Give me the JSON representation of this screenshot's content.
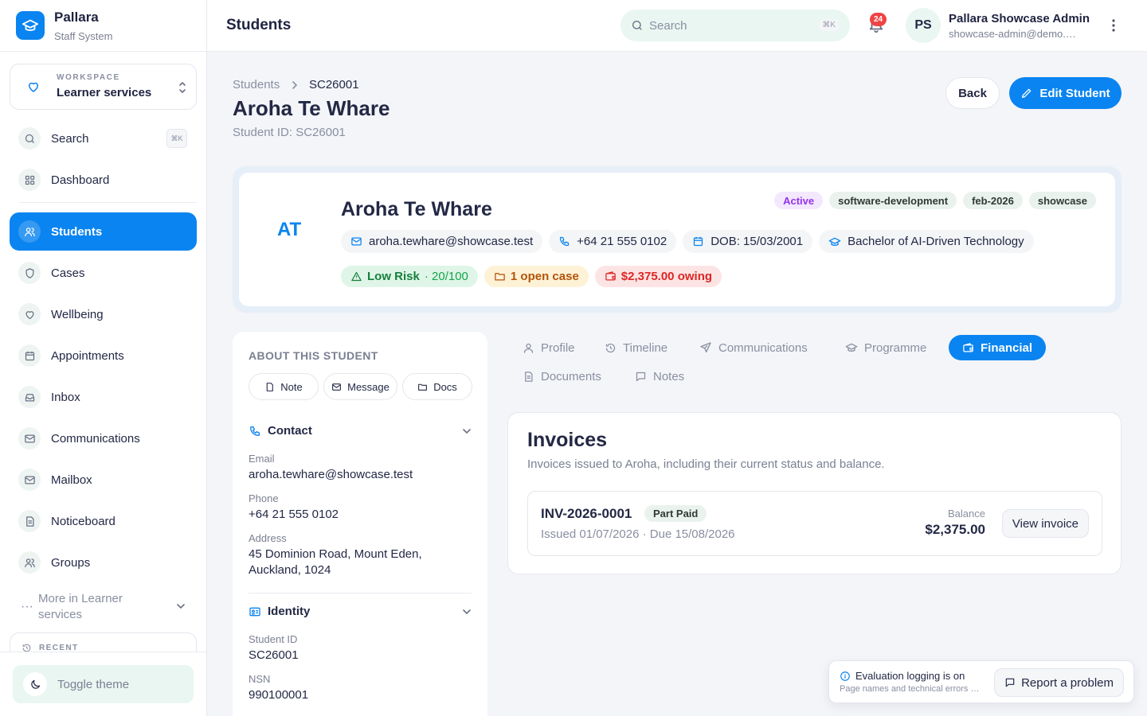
{
  "brand": {
    "name": "Pallara",
    "subtitle": "Staff System"
  },
  "workspace": {
    "label": "WORKSPACE",
    "name": "Learner services"
  },
  "sidebar": {
    "search": {
      "label": "Search",
      "shortcut": "⌘K"
    },
    "items": [
      {
        "label": "Dashboard",
        "icon": "grid-icon"
      },
      {
        "label": "Students",
        "icon": "users-icon",
        "active": true
      },
      {
        "label": "Cases",
        "icon": "shield-icon"
      },
      {
        "label": "Wellbeing",
        "icon": "heart-icon"
      },
      {
        "label": "Appointments",
        "icon": "calendar-icon"
      },
      {
        "label": "Inbox",
        "icon": "inbox-icon"
      },
      {
        "label": "Communications",
        "icon": "mail-icon"
      },
      {
        "label": "Mailbox",
        "icon": "mail-icon"
      },
      {
        "label": "Noticeboard",
        "icon": "document-icon"
      },
      {
        "label": "Groups",
        "icon": "users-icon"
      }
    ],
    "more_label": "More in Learner services",
    "recent_label": "RECENT",
    "toggle_theme": "Toggle theme"
  },
  "topbar": {
    "title": "Students",
    "search_placeholder": "Search",
    "search_shortcut": "⌘K",
    "notification_count": "24",
    "user_initials": "PS",
    "user_name": "Pallara Showcase Admin",
    "user_email": "showcase-admin@demo.pallara.test"
  },
  "breadcrumb": {
    "root": "Students",
    "current": "SC26001"
  },
  "page": {
    "title": "Aroha Te Whare",
    "subtitle": "Student ID: SC26001",
    "back_label": "Back",
    "edit_label": "Edit Student"
  },
  "student": {
    "initials": "AT",
    "name": "Aroha Te Whare",
    "tags": [
      "Active",
      "software-development",
      "feb-2026",
      "showcase"
    ],
    "email": "aroha.tewhare@showcase.test",
    "phone": "+64 21 555 0102",
    "dob": "DOB: 15/03/2001",
    "programme": "Bachelor of AI-Driven Technology",
    "risk_label": "Low Risk",
    "risk_score": "· 20/100",
    "open_cases": "1 open case",
    "owing": "$2,375.00 owing"
  },
  "about": {
    "heading": "ABOUT THIS STUDENT",
    "actions": [
      "Note",
      "Message",
      "Docs"
    ],
    "contact": {
      "title": "Contact",
      "email_label": "Email",
      "email": "aroha.tewhare@showcase.test",
      "phone_label": "Phone",
      "phone": "+64 21 555 0102",
      "address_label": "Address",
      "address": "45 Dominion Road, Mount Eden, Auckland, 1024"
    },
    "identity": {
      "title": "Identity",
      "student_id_label": "Student ID",
      "student_id": "SC26001",
      "nsn_label": "NSN",
      "nsn": "990100001"
    }
  },
  "tabs": [
    "Profile",
    "Timeline",
    "Communications",
    "Programme",
    "Financial",
    "Documents",
    "Notes"
  ],
  "active_tab": "Financial",
  "invoices": {
    "title": "Invoices",
    "description": "Invoices issued to Aroha, including their current status and balance.",
    "items": [
      {
        "number": "INV-2026-0001",
        "status": "Part Paid",
        "dates": "Issued 01/07/2026 · Due 15/08/2026",
        "balance_label": "Balance",
        "balance": "$2,375.00",
        "action": "View invoice"
      }
    ]
  },
  "toast": {
    "title": "Evaluation logging is on",
    "detail": "Page names and technical errors are recorded for evaluation.",
    "action": "Report a problem"
  },
  "colors": {
    "accent": "#0a84f0",
    "mint": "#e9f6f1",
    "risk_low": "#15803d",
    "warning": "#b45309",
    "danger": "#dc2626",
    "active_tag": "#9333ea"
  }
}
